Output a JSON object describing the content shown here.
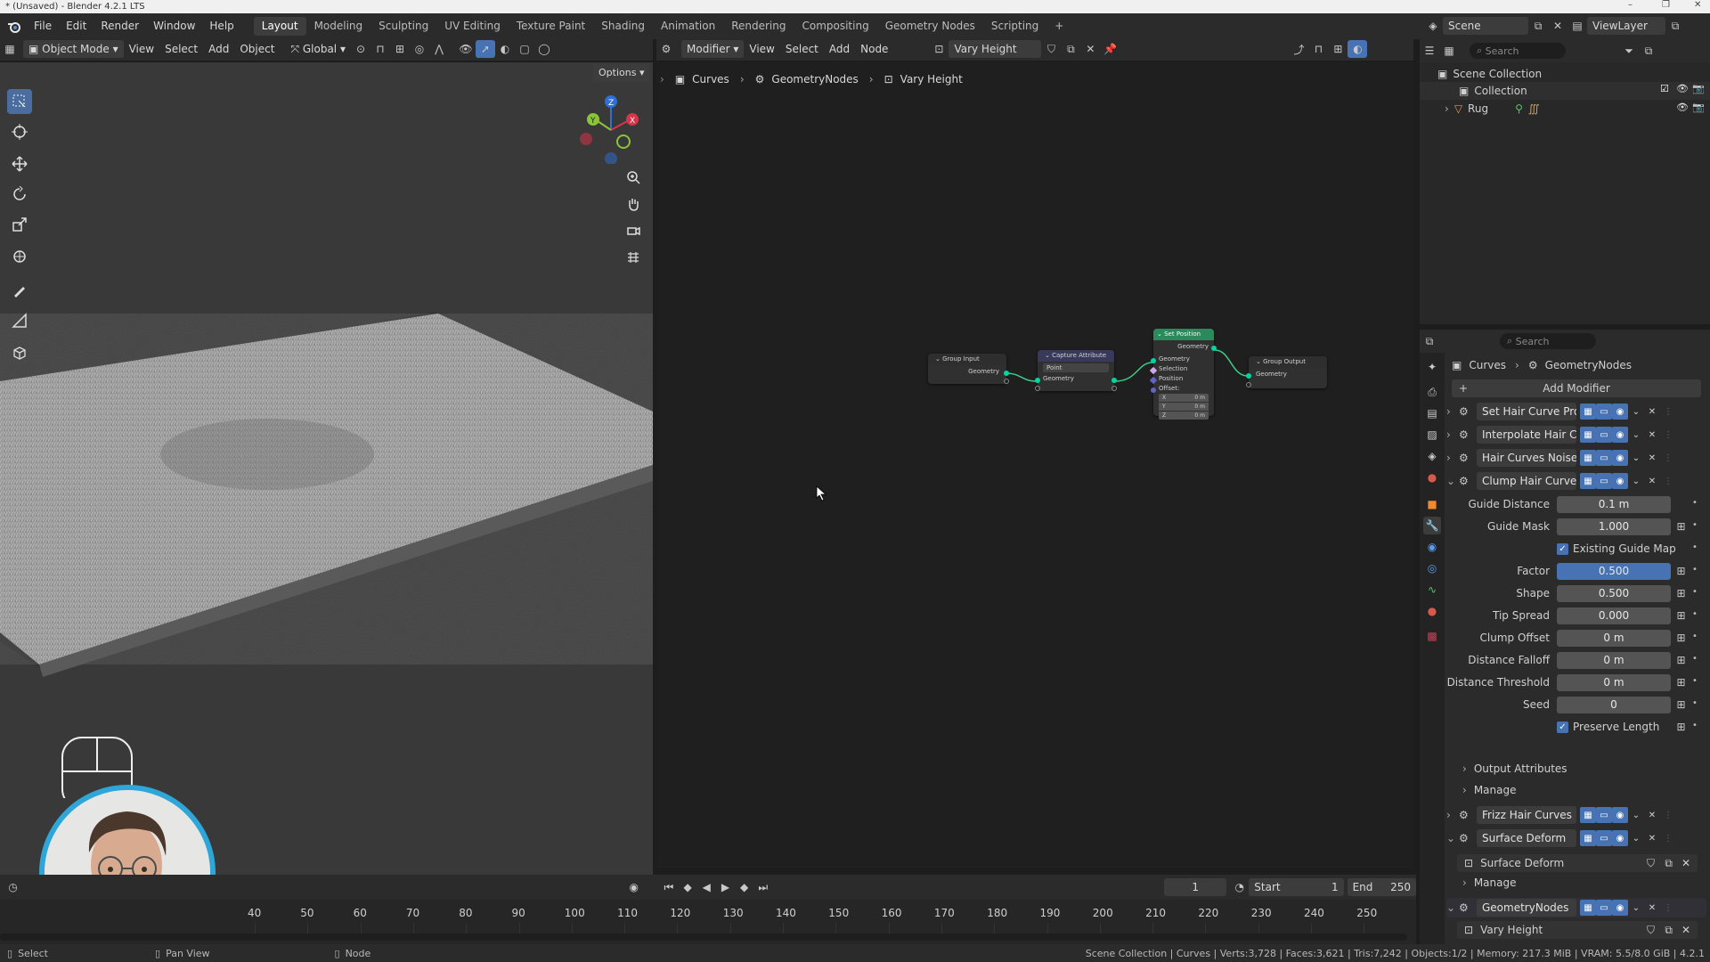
{
  "window": {
    "title": "* (Unsaved) - Blender 4.2.1 LTS"
  },
  "menu": [
    "File",
    "Edit",
    "Render",
    "Window",
    "Help"
  ],
  "workspaces": [
    "Layout",
    "Modeling",
    "Sculpting",
    "UV Editing",
    "Texture Paint",
    "Shading",
    "Animation",
    "Rendering",
    "Compositing",
    "Geometry Nodes",
    "Scripting"
  ],
  "active_workspace": "Layout",
  "scene": {
    "name": "Scene",
    "view_layer": "ViewLayer"
  },
  "viewport": {
    "mode": "Object Mode",
    "menus": [
      "View",
      "Select",
      "Add",
      "Object"
    ],
    "transform": "Global",
    "options_label": "Options"
  },
  "node_editor": {
    "editor_type": "Modifier",
    "menus": [
      "View",
      "Select",
      "Add",
      "Node"
    ],
    "node_group": "Vary Height",
    "breadcrumb": [
      "Curves",
      "GeometryNodes",
      "Vary Height"
    ],
    "nodes": {
      "group_input": {
        "title": "Group Input",
        "out": "Geometry"
      },
      "capture": {
        "title": "Capture Attribute",
        "domain": "Point",
        "socket": "Geometry"
      },
      "set_position": {
        "title": "Set Position",
        "out": "Geometry",
        "inputs": [
          "Geometry",
          "Selection",
          "Position",
          "Offset:"
        ],
        "offset": [
          {
            "axis": "X",
            "value": "0 m"
          },
          {
            "axis": "Y",
            "value": "0 m"
          },
          {
            "axis": "Z",
            "value": "0 m"
          }
        ]
      },
      "group_output": {
        "title": "Group Output",
        "in": "Geometry"
      }
    }
  },
  "outliner": {
    "search_placeholder": "Search",
    "root": "Scene Collection",
    "collection": "Collection",
    "object": "Rug"
  },
  "properties": {
    "search_placeholder": "Search",
    "breadcrumb": [
      "Curves",
      "GeometryNodes"
    ],
    "add_modifier": "Add Modifier",
    "modifiers": [
      {
        "name": "Set Hair Curve Pro..."
      },
      {
        "name": "Interpolate Hair C..."
      },
      {
        "name": "Hair Curves Noise"
      },
      {
        "name": "Clump Hair Curves"
      }
    ],
    "clump_fields": [
      {
        "label": "Guide Distance",
        "value": "0.1 m"
      },
      {
        "label": "Guide Mask",
        "value": "1.000"
      },
      {
        "label": "Factor",
        "value": "0.500"
      },
      {
        "label": "Shape",
        "value": "0.500"
      },
      {
        "label": "Tip Spread",
        "value": "0.000"
      },
      {
        "label": "Clump Offset",
        "value": "0 m"
      },
      {
        "label": "Distance Falloff",
        "value": "0 m"
      },
      {
        "label": "Distance Threshold",
        "value": "0 m"
      },
      {
        "label": "Seed",
        "value": "0"
      }
    ],
    "existing_guide_map": "Existing Guide Map",
    "preserve_length": "Preserve Length",
    "output_attributes": "Output Attributes",
    "manage": "Manage",
    "frizz": "Frizz Hair Curves",
    "surface_deform": "Surface Deform",
    "surface_deform_sub": "Surface Deform",
    "manage2": "Manage",
    "geometry_nodes": "GeometryNodes",
    "vary_height": "Vary Height"
  },
  "timeline": {
    "current_frame": "1",
    "start_label": "Start",
    "start": "1",
    "end_label": "End",
    "end": "250",
    "ticks": [
      "40",
      "50",
      "60",
      "70",
      "80",
      "90",
      "100",
      "110",
      "120",
      "130",
      "140",
      "150",
      "160",
      "170",
      "180",
      "190",
      "200",
      "210",
      "220",
      "230",
      "240",
      "250"
    ]
  },
  "status": {
    "left": [
      "Select",
      "Pan View",
      "Node"
    ],
    "right": "Scene Collection | Curves | Verts:3,728 | Faces:3,621 | Tris:7,242 | Objects:1/2 | Memory: 217.3 MiB | VRAM: 5.5/8.0 GiB | 4.2.1"
  },
  "colors": {
    "accent": "#4772b3",
    "node_green_header": "#2a8a5c",
    "link": "#3ec98a",
    "geometry_socket": "#00d6a3",
    "panel": "#2b2b2b"
  }
}
